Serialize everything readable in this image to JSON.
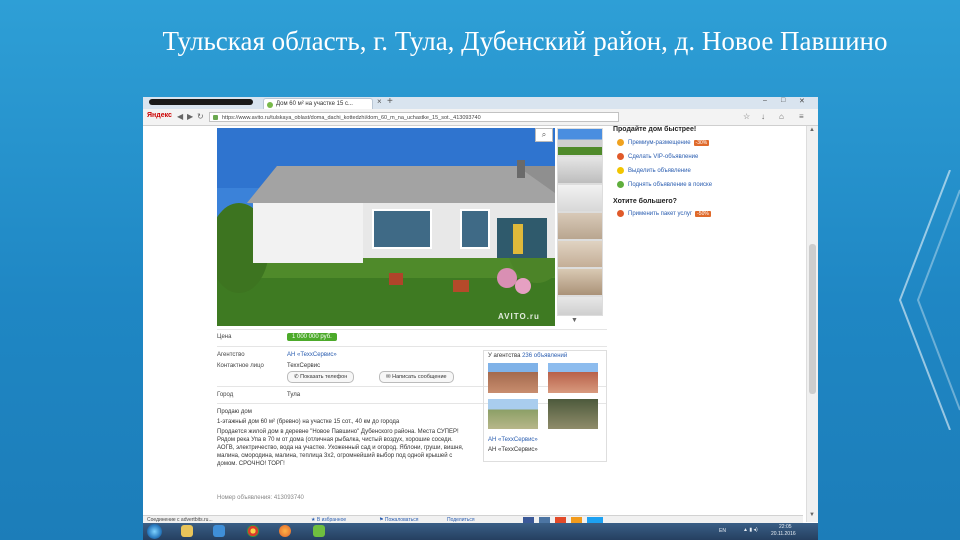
{
  "slide": {
    "title": "Тульская область, г. Тула, Дубенский район, д. Новое Павшино"
  },
  "browser": {
    "tab_title": "Дом 60 м² на участке 15 с...",
    "tab_close": "×",
    "new_tab": "+",
    "yandex_label": "Яндекс",
    "address": "https://www.avito.ru/tulskaya_oblast/doma_dachi_kottedzhi/dom_60_m_na_uchastke_15_sot._413093740",
    "controls": {
      "minimize": "–",
      "maximize": "□",
      "close": "✕"
    }
  },
  "listing": {
    "watermark": "AVITO.ru",
    "rows": [
      {
        "label": "Цена",
        "value": ""
      },
      {
        "label": "Агентство",
        "value": "АН «ТеххСервис»"
      },
      {
        "label": "Контактное лицо",
        "value": "ТеххСервис"
      },
      {
        "label": "Город",
        "value": "Тула"
      }
    ],
    "price": "1 000 000 руб.",
    "buttons": {
      "phone": "Показать телефон",
      "message": "Написать сообщение"
    },
    "description": [
      "Продаю дом",
      "1-этажный дом 60 м² (бревно) на участке 15 сот., 40 км до города",
      "Продается жилой дом в деревне \"Новое Павшино\" Дубенского района. Места СУПЕР! Рядом река Упа в 70 м от дома (отличная рыбалка, чистый воздух, хорошие соседи. АОГВ, электричество, вода на участке. Ухоженный сад и огород. Яблони, груши, вишня, малина, смородина, малина, теплица 3х2, огромнейший выбор под одной крышей с домом. СРОЧНО! ТОРГ!"
    ],
    "ad_number": "Номер объявления: 413093740"
  },
  "sidebar": {
    "sell_heading": "Продайте дом быстрее!",
    "items": [
      {
        "label": "Премиум-размещение",
        "badge": "-30%",
        "color": "#f0a21f"
      },
      {
        "label": "Сделать VIP-объявление",
        "badge": "",
        "color": "#e05a2a"
      },
      {
        "label": "Выделить объявление",
        "badge": "",
        "color": "#f2c500"
      },
      {
        "label": "Поднять объявление в поиске",
        "badge": "",
        "color": "#5fae3d"
      }
    ],
    "more_heading": "Хотите большего?",
    "more_items": [
      {
        "label": "Применить пакет услуг",
        "badge": "-50%",
        "color": "#e05a2a"
      }
    ]
  },
  "agency": {
    "prefix": "У агентства",
    "count": "236 объявлений",
    "name": "АН «ТеххСервис»",
    "subname": "АН «ТеххСервис»"
  },
  "statusbar": {
    "left": "Соединение с advertbits.ru...",
    "fav": "★ В избранное",
    "complain": "⚑ Пожаловаться",
    "share": "Поделиться"
  },
  "taskbar": {
    "lang": "EN",
    "time": "22:05",
    "date": "20.11.2016"
  },
  "colors": {
    "slide_bg": "#1f87c4",
    "price_green": "#4caa2a",
    "link_blue": "#2a5db0"
  }
}
